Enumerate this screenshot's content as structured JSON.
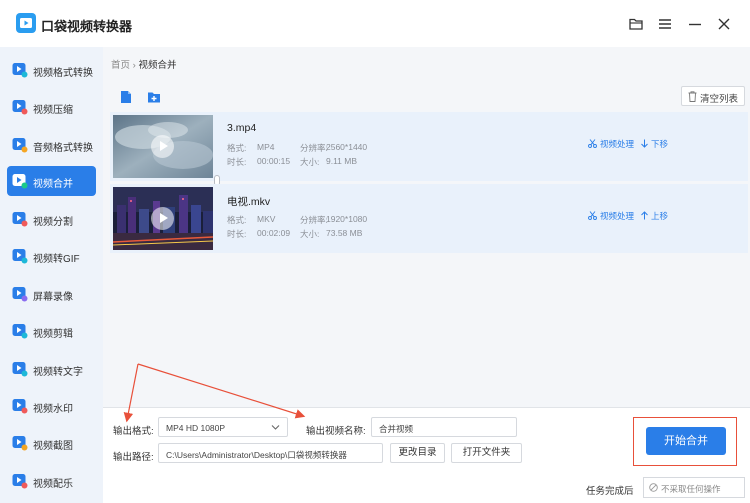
{
  "app": {
    "title": "口袋视频转换器",
    "accent": "#2a7ee8",
    "annotation_color": "#e8503a"
  },
  "window_controls": [
    {
      "icon": "folder-icon"
    },
    {
      "icon": "menu-icon"
    },
    {
      "icon": "minimize-icon"
    },
    {
      "icon": "close-icon"
    }
  ],
  "sidebar": {
    "items": [
      {
        "label": "视频格式转换",
        "icon": "video-convert-icon"
      },
      {
        "label": "视频压缩",
        "icon": "video-compress-icon"
      },
      {
        "label": "音频格式转换",
        "icon": "audio-convert-icon"
      },
      {
        "label": "视频合并",
        "icon": "video-merge-icon",
        "active": true
      },
      {
        "label": "视频分割",
        "icon": "video-split-icon"
      },
      {
        "label": "视频转GIF",
        "icon": "video-gif-icon"
      },
      {
        "label": "屏幕录像",
        "icon": "screen-record-icon"
      },
      {
        "label": "视频剪辑",
        "icon": "video-edit-icon"
      },
      {
        "label": "视频转文字",
        "icon": "video-text-icon"
      },
      {
        "label": "视频水印",
        "icon": "video-watermark-icon"
      },
      {
        "label": "视频截图",
        "icon": "video-screenshot-icon"
      },
      {
        "label": "视频配乐",
        "icon": "video-music-icon"
      }
    ]
  },
  "breadcrumb": {
    "home": "首页",
    "separator": "›",
    "current": "视频合并"
  },
  "toolbar": {
    "clear_label": "清空列表"
  },
  "files": [
    {
      "name": "3.mp4",
      "format_label": "格式:",
      "format": "MP4",
      "resolution_label": "分辨率:",
      "resolution": "2560*1440",
      "duration_label": "时长:",
      "duration": "00:00:15",
      "size_label": "大小:",
      "size": "9.11 MB",
      "process_label": "视频处理",
      "move_label": "下移"
    },
    {
      "name": "电视.mkv",
      "format_label": "格式:",
      "format": "MKV",
      "resolution_label": "分辨率:",
      "resolution": "1920*1080",
      "duration_label": "时长:",
      "duration": "00:02:09",
      "size_label": "大小:",
      "size": "73.58 MB",
      "process_label": "视频处理",
      "move_label": "上移"
    }
  ],
  "output": {
    "format_label": "输出格式:",
    "format_value": "MP4  HD 1080P",
    "name_label": "输出视频名称:",
    "name_value": "合并视频",
    "path_label": "输出路径:",
    "path_value": "C:\\Users\\Administrator\\Desktop\\口袋视频转换器",
    "change_dir_label": "更改目录",
    "open_folder_label": "打开文件夹",
    "start_label": "开始合并",
    "task_label": "任务完成后",
    "task_value": "不采取任何操作"
  }
}
